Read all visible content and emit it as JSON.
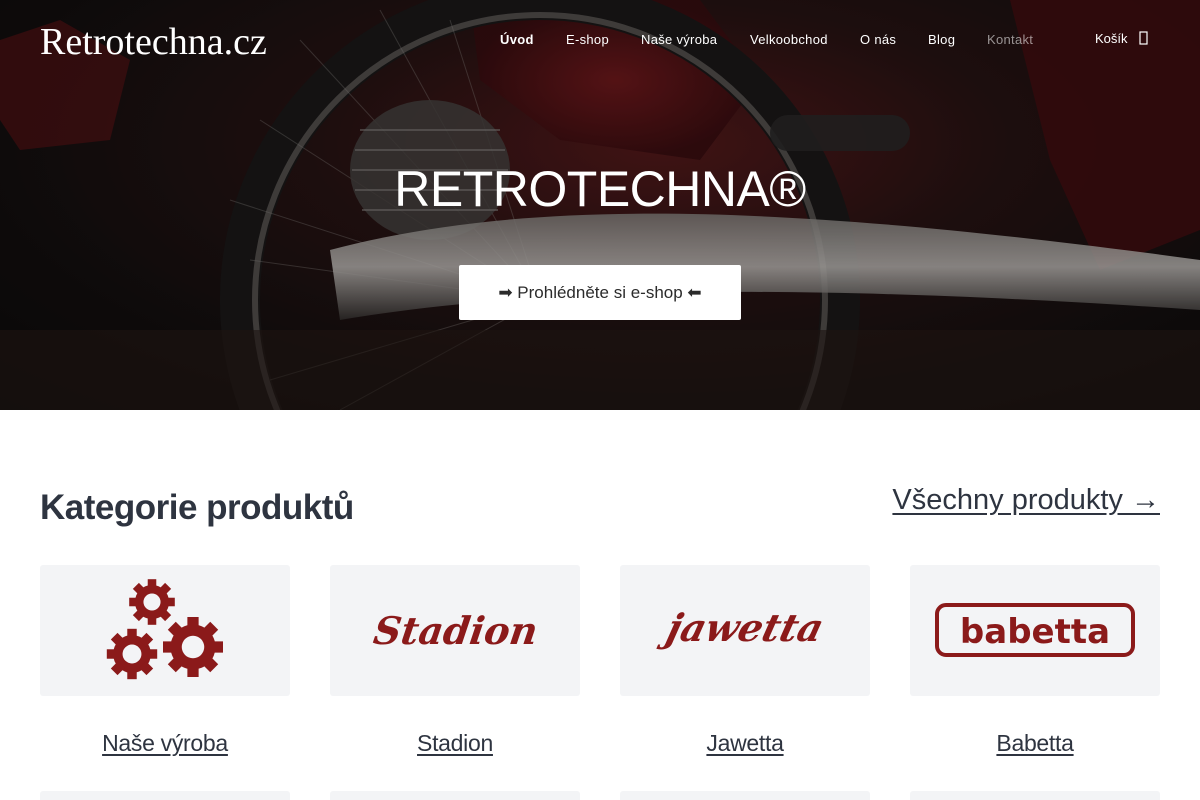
{
  "header": {
    "brand": "Retrotechna.cz",
    "nav": [
      {
        "label": "Úvod",
        "active": true
      },
      {
        "label": "E-shop"
      },
      {
        "label": "Naše výroba"
      },
      {
        "label": "Velkoobchod"
      },
      {
        "label": "O nás"
      },
      {
        "label": "Blog"
      },
      {
        "label": "Kontakt"
      }
    ],
    "cart_label": "Košík",
    "cart_icon": "shopping-bag-icon"
  },
  "hero": {
    "title": "RETROTECHNA®",
    "cta_label": "➡ Prohlédněte si e-shop ⬅"
  },
  "categories_section": {
    "title": "Kategorie produktů",
    "all_products_link": "Všechny produkty →",
    "items": [
      {
        "label": "Naše výroba",
        "icon": "gears-icon"
      },
      {
        "label": "Stadion",
        "logo_text": "Stadion"
      },
      {
        "label": "Jawetta",
        "logo_text": "jawetta"
      },
      {
        "label": "Babetta",
        "logo_text": "babetta"
      }
    ]
  },
  "colors": {
    "accent": "#8b1a1a",
    "text": "#2e3440",
    "card_bg": "#f3f4f6"
  }
}
